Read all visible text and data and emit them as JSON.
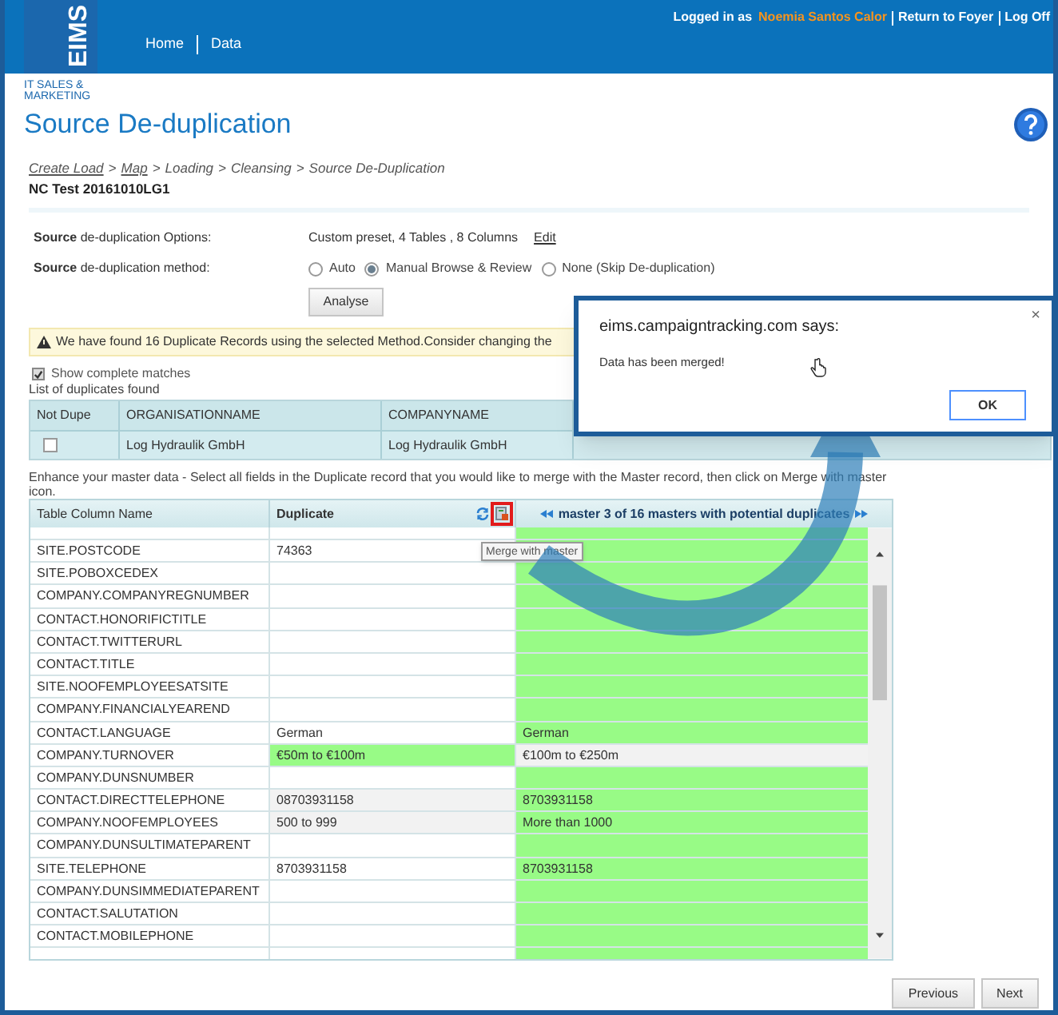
{
  "header": {
    "logo": "EIMS",
    "tagline": "IT SALES & MARKETING",
    "user_prefix": "Logged in as",
    "user_name": "Noemia Santos Calor",
    "links": [
      "Return to Foyer",
      "Log Off"
    ],
    "nav": [
      "Home",
      "Data"
    ]
  },
  "page": {
    "title": "Source De-duplication",
    "breadcrumb_separator": ">",
    "breadcrumb": [
      {
        "label": "Create Load",
        "link": true
      },
      {
        "label": "Map",
        "link": true
      },
      {
        "label": "Loading",
        "link": false
      },
      {
        "label": "Cleansing",
        "link": false
      },
      {
        "label": "Source De-Duplication",
        "link": false
      }
    ],
    "load_name": "NC Test 20161010LG1"
  },
  "options": {
    "label": "**Source** de-duplication Options:",
    "value": "Custom preset, 4 Tables , 8 Columns",
    "link": "Edit"
  },
  "method": {
    "label": "**Source** de-duplication method:",
    "choices": [
      {
        "label": "Auto",
        "selected": false
      },
      {
        "label": "Manual Browse & Review",
        "selected": true
      },
      {
        "label": "None (Skip De-duplication)",
        "selected": false
      }
    ]
  },
  "analyse_button": "Analyse",
  "warning": "We have found 16 Duplicate Records using the selected Method.Consider changing the",
  "show_complete_matches": {
    "label": "Show complete matches",
    "checked": true
  },
  "duplicates": {
    "title": "List of duplicates found",
    "columns": [
      "Not Dupe",
      "ORGANISATIONNAME",
      "COMPANYNAME"
    ],
    "rows": [
      {
        "cells": [
          {
            "kind": "checkbox",
            "checked": false
          },
          {
            "kind": "text",
            "text": "Log Hydraulik GmbH"
          },
          {
            "kind": "text",
            "text": "Log Hydraulik GmbH"
          }
        ]
      }
    ]
  },
  "instructions": "Enhance your master data - Select all fields in the Duplicate record that you would like to merge with the Master record, then click on Merge with master icon.",
  "merge_table": {
    "columns": [
      "Table Column Name",
      "Duplicate"
    ],
    "master_header": "master 3 of 16 masters with potential duplicates",
    "tooltip": "Merge with master",
    "rows": [
      {
        "field": "SITE.POSTCODE",
        "duplicate": {
          "value": "74363",
          "chosen": false,
          "differs": false
        },
        "master": {
          "chosen": true,
          "differs": false
        }
      },
      {
        "field": "SITE.POBOXCEDEX",
        "duplicate": {
          "chosen": false,
          "differs": false
        },
        "master": {
          "chosen": true,
          "differs": false
        }
      },
      {
        "field": "COMPANY.COMPANYREGNUMBER",
        "duplicate": {
          "chosen": false,
          "differs": false
        },
        "master": {
          "chosen": true,
          "differs": false
        }
      },
      {
        "field": "CONTACT.HONORIFICTITLE",
        "duplicate": {
          "chosen": false,
          "differs": false
        },
        "master": {
          "chosen": true,
          "differs": false
        }
      },
      {
        "field": "CONTACT.TWITTERURL",
        "duplicate": {
          "chosen": false,
          "differs": false
        },
        "master": {
          "chosen": true,
          "differs": false
        }
      },
      {
        "field": "CONTACT.TITLE",
        "duplicate": {
          "chosen": false,
          "differs": false
        },
        "master": {
          "chosen": true,
          "differs": false
        }
      },
      {
        "field": "SITE.NOOFEMPLOYEESATSITE",
        "duplicate": {
          "chosen": false,
          "differs": false
        },
        "master": {
          "chosen": true,
          "differs": false
        }
      },
      {
        "field": "COMPANY.FINANCIALYEAREND",
        "duplicate": {
          "chosen": false,
          "differs": false
        },
        "master": {
          "chosen": true,
          "differs": false
        }
      },
      {
        "field": "CONTACT.LANGUAGE",
        "duplicate": {
          "value": "German",
          "chosen": false,
          "differs": false
        },
        "master": {
          "value": "German",
          "chosen": true,
          "differs": false
        }
      },
      {
        "field": "COMPANY.TURNOVER",
        "duplicate": {
          "value": "€50m to €100m",
          "chosen": true,
          "differs": false
        },
        "master": {
          "value": "€100m to €250m",
          "chosen": false,
          "differs": true
        }
      },
      {
        "field": "COMPANY.DUNSNUMBER",
        "duplicate": {
          "chosen": false,
          "differs": false
        },
        "master": {
          "chosen": true,
          "differs": false
        }
      },
      {
        "field": "CONTACT.DIRECTTELEPHONE",
        "duplicate": {
          "value": "08703931158",
          "chosen": false,
          "differs": true
        },
        "master": {
          "value": "8703931158",
          "chosen": true,
          "differs": false
        }
      },
      {
        "field": "COMPANY.NOOFEMPLOYEES",
        "duplicate": {
          "value": "500 to 999",
          "chosen": false,
          "differs": true
        },
        "master": {
          "value": "More than 1000",
          "chosen": true,
          "differs": false
        }
      },
      {
        "field": "COMPANY.DUNSULTIMATEPARENT",
        "duplicate": {
          "chosen": false,
          "differs": false
        },
        "master": {
          "chosen": true,
          "differs": false
        }
      },
      {
        "field": "SITE.TELEPHONE",
        "duplicate": {
          "value": "8703931158",
          "chosen": false,
          "differs": false
        },
        "master": {
          "value": "8703931158",
          "chosen": true,
          "differs": false
        }
      },
      {
        "field": "COMPANY.DUNSIMMEDIATEPARENT",
        "duplicate": {
          "chosen": false,
          "differs": false
        },
        "master": {
          "chosen": true,
          "differs": false
        }
      },
      {
        "field": "CONTACT.SALUTATION",
        "duplicate": {
          "chosen": false,
          "differs": false
        },
        "master": {
          "chosen": true,
          "differs": false
        }
      },
      {
        "field": "CONTACT.MOBILEPHONE",
        "duplicate": {
          "chosen": false,
          "differs": false
        },
        "master": {
          "chosen": true,
          "differs": false
        }
      }
    ]
  },
  "buttons": [
    "Previous",
    "Next"
  ],
  "dialog": {
    "title": "eims.campaigntracking.com says:",
    "message": "Data has been merged!",
    "close": "×",
    "button": "OK"
  }
}
